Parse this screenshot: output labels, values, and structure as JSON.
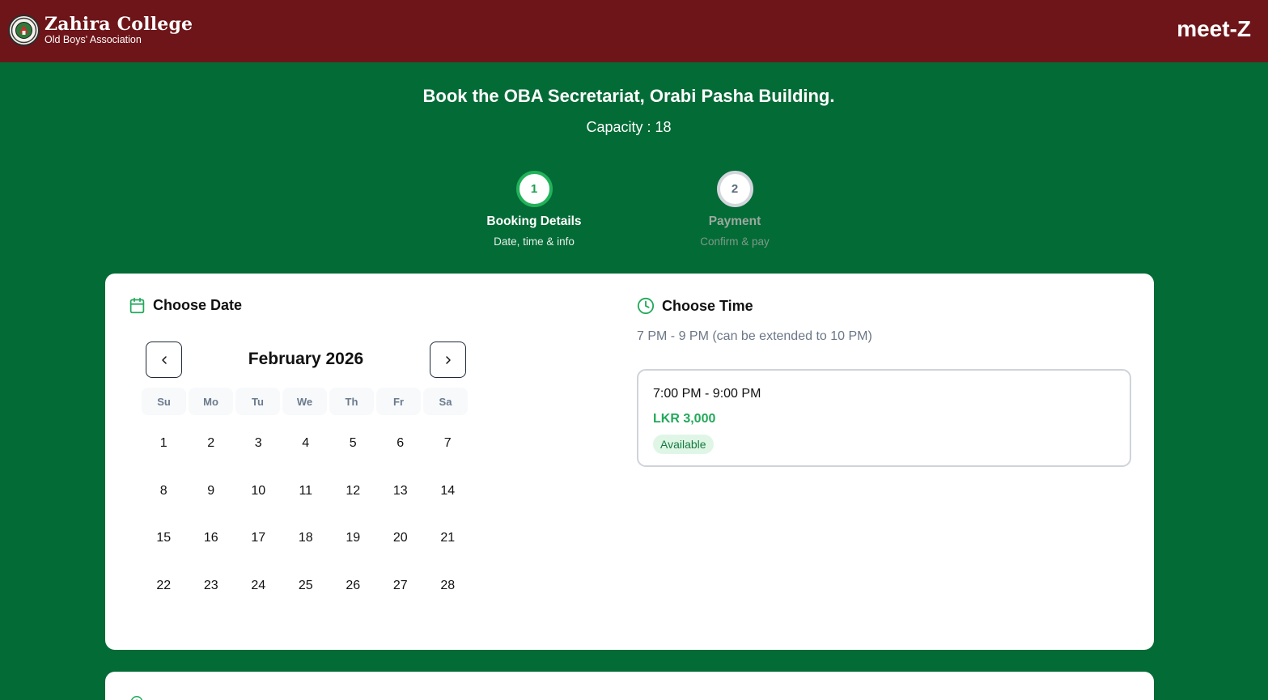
{
  "header": {
    "brand_name": "Zahira College",
    "brand_subtitle": "Old Boys' Association",
    "app_name": "meet-Z",
    "colors": {
      "header_bg": "#6e1519",
      "page_bg": "#036b36"
    }
  },
  "page": {
    "title": "Book the OBA Secretariat, Orabi Pasha Building.",
    "capacity": "Capacity : 18"
  },
  "steps": [
    {
      "number": "1",
      "title": "Booking Details",
      "description": "Date, time & info",
      "state": "active"
    },
    {
      "number": "2",
      "title": "Payment",
      "description": "Confirm & pay",
      "state": "inactive"
    }
  ],
  "date_section": {
    "heading": "Choose Date",
    "icon": "calendar-icon",
    "month": "February 2026",
    "prev_icon": "chevron-left-icon",
    "next_icon": "chevron-right-icon",
    "weekdays": [
      "Su",
      "Mo",
      "Tu",
      "We",
      "Th",
      "Fr",
      "Sa"
    ],
    "days": [
      "1",
      "2",
      "3",
      "4",
      "5",
      "6",
      "7",
      "8",
      "9",
      "10",
      "11",
      "12",
      "13",
      "14",
      "15",
      "16",
      "17",
      "18",
      "19",
      "20",
      "21",
      "22",
      "23",
      "24",
      "25",
      "26",
      "27",
      "28"
    ]
  },
  "time_section": {
    "heading": "Choose Time",
    "icon": "clock-icon",
    "note": "7 PM - 9 PM (can be extended to 10 PM)",
    "slots": [
      {
        "time": "7:00 PM - 9:00 PM",
        "price": "LKR 3,000",
        "status": "Available"
      }
    ]
  },
  "accent_color": "#22a95a"
}
